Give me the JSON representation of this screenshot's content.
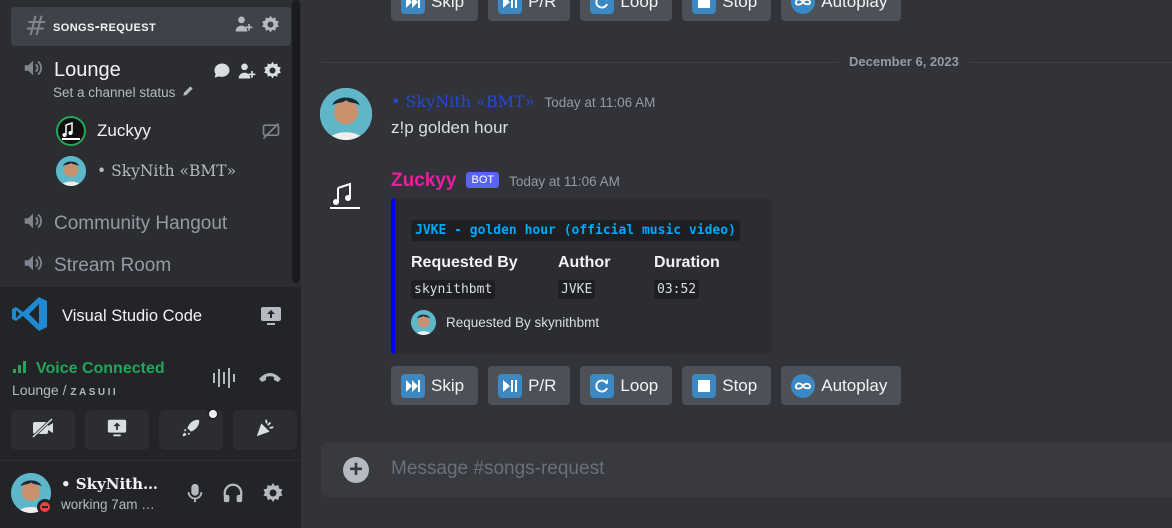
{
  "sidebar": {
    "active_channel": "songs-request",
    "voice_channels": [
      {
        "name": "Lounge",
        "status": "Set a channel status"
      },
      {
        "name": "Community Hangout"
      },
      {
        "name": "Stream Room"
      }
    ],
    "voice_users": [
      {
        "name": "Zuckyy"
      },
      {
        "name": "• SkyNith «BMT»"
      }
    ]
  },
  "activity": {
    "app": "Visual Studio Code"
  },
  "voice_panel": {
    "title": "Voice Connected",
    "channel": "Lounge / ",
    "server": "ZASUII"
  },
  "user_panel": {
    "name": "• SkyNith…",
    "status": "working 7am …"
  },
  "chat": {
    "date_divider": "December 6, 2023",
    "buttons": [
      {
        "label": "Skip",
        "icon": "next-track-icon"
      },
      {
        "label": "P/R",
        "icon": "play-pause-icon"
      },
      {
        "label": "Loop",
        "icon": "loop-icon"
      },
      {
        "label": "Stop",
        "icon": "stop-icon"
      },
      {
        "label": "Autoplay",
        "icon": "infinity-icon"
      }
    ],
    "messages": [
      {
        "author": "• SkyNith «BMT»",
        "timestamp": "Today at 11:06 AM",
        "text": "z!p golden hour"
      },
      {
        "author": "Zuckyy",
        "bot_tag": "BOT",
        "timestamp": "Today at 11:06 AM"
      }
    ],
    "embed": {
      "title": "JVKE - golden hour (official music video)",
      "color": "#0000ff",
      "fields": [
        {
          "name": "Requested By",
          "value": "skynithbmt"
        },
        {
          "name": "Author",
          "value": "JVKE"
        },
        {
          "name": "Duration",
          "value": "03:52"
        }
      ],
      "footer": "Requested By skynithbmt"
    },
    "composer_placeholder": "Message #songs-request"
  },
  "colors": {
    "background": "#313338",
    "sidebar": "#2b2d31",
    "voice_connected": "#23a55a",
    "bot_name": "#e91ea0",
    "user_name": "#1f4bd7",
    "button_icon": "#3b88c3"
  }
}
